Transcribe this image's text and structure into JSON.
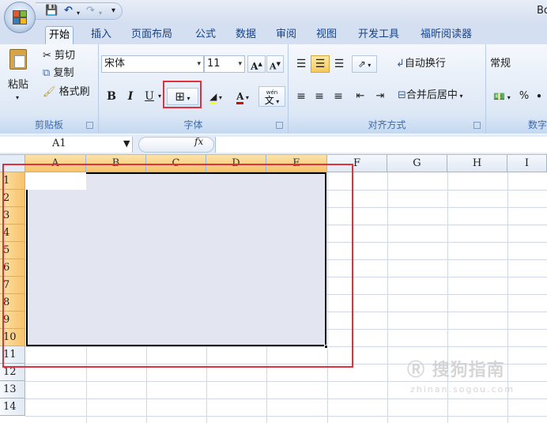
{
  "window": {
    "title": "Bo"
  },
  "quick_access": {
    "items": [
      "save-icon",
      "undo-icon",
      "redo-icon",
      "customize-icon"
    ]
  },
  "tabs": [
    {
      "label": "开始",
      "active": true
    },
    {
      "label": "插入"
    },
    {
      "label": "页面布局"
    },
    {
      "label": "公式"
    },
    {
      "label": "数据"
    },
    {
      "label": "审阅"
    },
    {
      "label": "视图"
    },
    {
      "label": "开发工具"
    },
    {
      "label": "福昕阅读器"
    }
  ],
  "ribbon": {
    "clipboard": {
      "label": "剪贴板",
      "paste": "粘贴",
      "cut": "剪切",
      "copy": "复制",
      "format_painter": "格式刷"
    },
    "font": {
      "label": "字体",
      "font_name": "宋体",
      "font_size": "11",
      "bold": "B",
      "italic": "I",
      "underline": "U",
      "increase_size": "A",
      "decrease_size": "A",
      "font_color_glyph": "A",
      "phonetic_glyph": "wén",
      "phonetic_char": "文"
    },
    "alignment": {
      "label": "对齐方式",
      "wrap_text": "自动换行",
      "merge_center": "合并后居中"
    },
    "number": {
      "label": "数字",
      "format": "常规",
      "percent": "%"
    }
  },
  "formula_bar": {
    "name_box": "A1",
    "fx": "fx",
    "formula": ""
  },
  "grid": {
    "columns": [
      "A",
      "B",
      "C",
      "D",
      "E",
      "F",
      "G",
      "H",
      "I"
    ],
    "rows": [
      "1",
      "2",
      "3",
      "4",
      "5",
      "6",
      "7",
      "8",
      "9",
      "10",
      "11",
      "12",
      "13",
      "14"
    ],
    "selected_range": "A1:E10"
  },
  "watermark": {
    "text": "搜狗指南",
    "url": "zhinan.sogou.com"
  },
  "colors": {
    "highlight": "#e3303d",
    "selection_header": "#f7c26a",
    "selection_fill": "#e3e6f1"
  }
}
